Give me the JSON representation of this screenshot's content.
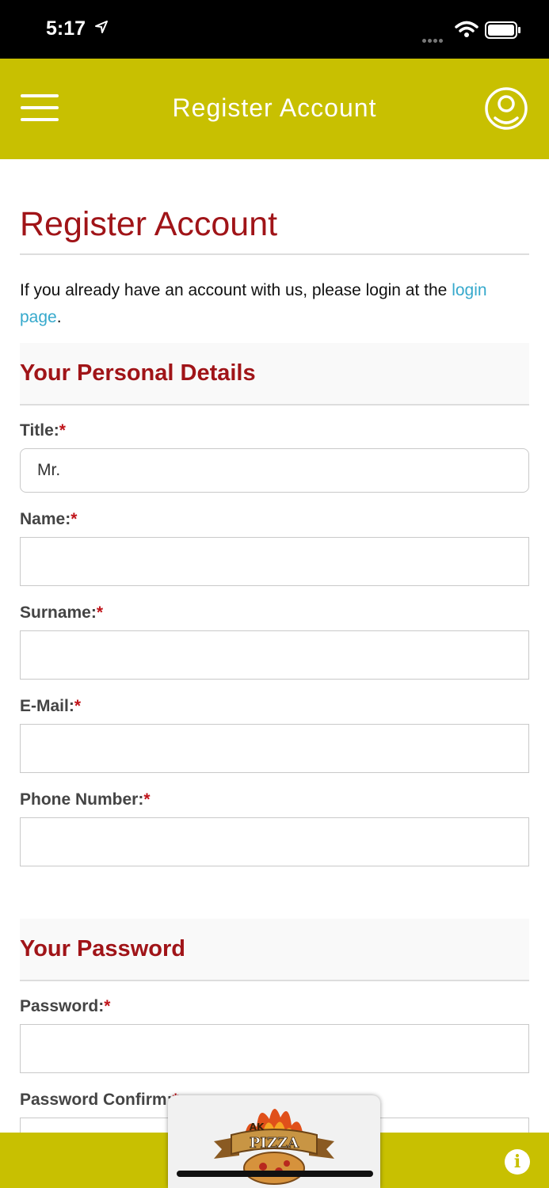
{
  "status": {
    "time": "5:17"
  },
  "navbar": {
    "title": "Register Account",
    "menu_icon": "hamburger-icon",
    "user_icon": "user-icon"
  },
  "page": {
    "heading": "Register Account",
    "intro_text": "If you already have an account with us, please login at the ",
    "intro_link": "login page",
    "intro_end": "."
  },
  "personal": {
    "heading": "Your Personal Details",
    "title_label": "Title:",
    "title_value": "Mr.",
    "name_label": "Name:",
    "surname_label": "Surname:",
    "email_label": "E-Mail:",
    "phone_label": "Phone Number:"
  },
  "password": {
    "heading": "Your Password",
    "password_label": "Password:",
    "confirm_label": "Password Confirm:"
  },
  "required_mark": "*",
  "logo": {
    "text": "PIZZA",
    "small": "AK"
  },
  "colors": {
    "accent": "#c8c001",
    "heading": "#a01418",
    "link": "#36a9cc"
  }
}
